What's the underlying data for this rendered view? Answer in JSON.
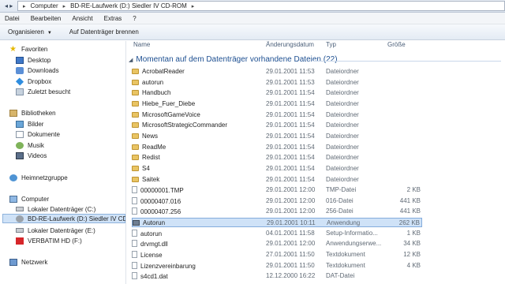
{
  "address": {
    "crumbs": [
      "Computer",
      "BD-RE-Laufwerk (D:) Siedler IV CD-ROM"
    ]
  },
  "menu": [
    "Datei",
    "Bearbeiten",
    "Ansicht",
    "Extras",
    "?"
  ],
  "toolbar": {
    "organize": "Organisieren",
    "burn": "Auf Datenträger brennen"
  },
  "nav": {
    "favorites": "Favoriten",
    "desktop": "Desktop",
    "downloads": "Downloads",
    "dropbox": "Dropbox",
    "recent": "Zuletzt besucht",
    "libraries": "Bibliotheken",
    "pictures": "Bilder",
    "documents": "Dokumente",
    "music": "Musik",
    "videos": "Videos",
    "homegroup": "Heimnetzgruppe",
    "computer": "Computer",
    "drive_c": "Lokaler Datenträger (C:)",
    "drive_d": "BD-RE-Laufwerk (D:) Siedler IV CD-R",
    "drive_e": "Lokaler Datenträger (E:)",
    "drive_f": "VERBATIM HD (F:)",
    "network": "Netzwerk"
  },
  "columns": {
    "name": "Name",
    "date": "Änderungsdatum",
    "type": "Typ",
    "size": "Größe"
  },
  "group": "Momentan auf dem Datenträger vorhandene Dateien (22)",
  "files": [
    {
      "name": "AcrobatReader",
      "date": "29.01.2001 11:53",
      "type": "Dateiordner",
      "size": "",
      "kind": "folder"
    },
    {
      "name": "autorun",
      "date": "29.01.2001 11:53",
      "type": "Dateiordner",
      "size": "",
      "kind": "folder"
    },
    {
      "name": "Handbuch",
      "date": "29.01.2001 11:54",
      "type": "Dateiordner",
      "size": "",
      "kind": "folder"
    },
    {
      "name": "Hiebe_Fuer_Diebe",
      "date": "29.01.2001 11:54",
      "type": "Dateiordner",
      "size": "",
      "kind": "folder"
    },
    {
      "name": "MicrosoftGameVoice",
      "date": "29.01.2001 11:54",
      "type": "Dateiordner",
      "size": "",
      "kind": "folder"
    },
    {
      "name": "MicrosoftStrategicCommander",
      "date": "29.01.2001 11:54",
      "type": "Dateiordner",
      "size": "",
      "kind": "folder"
    },
    {
      "name": "News",
      "date": "29.01.2001 11:54",
      "type": "Dateiordner",
      "size": "",
      "kind": "folder"
    },
    {
      "name": "ReadMe",
      "date": "29.01.2001 11:54",
      "type": "Dateiordner",
      "size": "",
      "kind": "folder"
    },
    {
      "name": "Redist",
      "date": "29.01.2001 11:54",
      "type": "Dateiordner",
      "size": "",
      "kind": "folder"
    },
    {
      "name": "S4",
      "date": "29.01.2001 11:54",
      "type": "Dateiordner",
      "size": "",
      "kind": "folder"
    },
    {
      "name": "Saitek",
      "date": "29.01.2001 11:54",
      "type": "Dateiordner",
      "size": "",
      "kind": "folder"
    },
    {
      "name": "00000001.TMP",
      "date": "29.01.2001 12:00",
      "type": "TMP-Datei",
      "size": "2 KB",
      "kind": "file"
    },
    {
      "name": "00000407.016",
      "date": "29.01.2001 12:00",
      "type": "016-Datei",
      "size": "441 KB",
      "kind": "file"
    },
    {
      "name": "00000407.256",
      "date": "29.01.2001 12:00",
      "type": "256-Datei",
      "size": "441 KB",
      "kind": "file"
    },
    {
      "name": "Autorun",
      "date": "29.01.2001 10:11",
      "type": "Anwendung",
      "size": "262 KB",
      "kind": "app"
    },
    {
      "name": "autorun",
      "date": "04.01.2001 11:58",
      "type": "Setup-Informatio...",
      "size": "1 KB",
      "kind": "file"
    },
    {
      "name": "drvmgt.dll",
      "date": "29.01.2001 12:00",
      "type": "Anwendungserwe...",
      "size": "34 KB",
      "kind": "file"
    },
    {
      "name": "License",
      "date": "27.01.2001 11:50",
      "type": "Textdokument",
      "size": "12 KB",
      "kind": "file"
    },
    {
      "name": "Lizenzvereinbarung",
      "date": "29.01.2001 11:50",
      "type": "Textdokument",
      "size": "4 KB",
      "kind": "file"
    },
    {
      "name": "s4cd1.dat",
      "date": "12.12.2000 16:22",
      "type": "DAT-Datei",
      "size": "",
      "kind": "file"
    }
  ]
}
